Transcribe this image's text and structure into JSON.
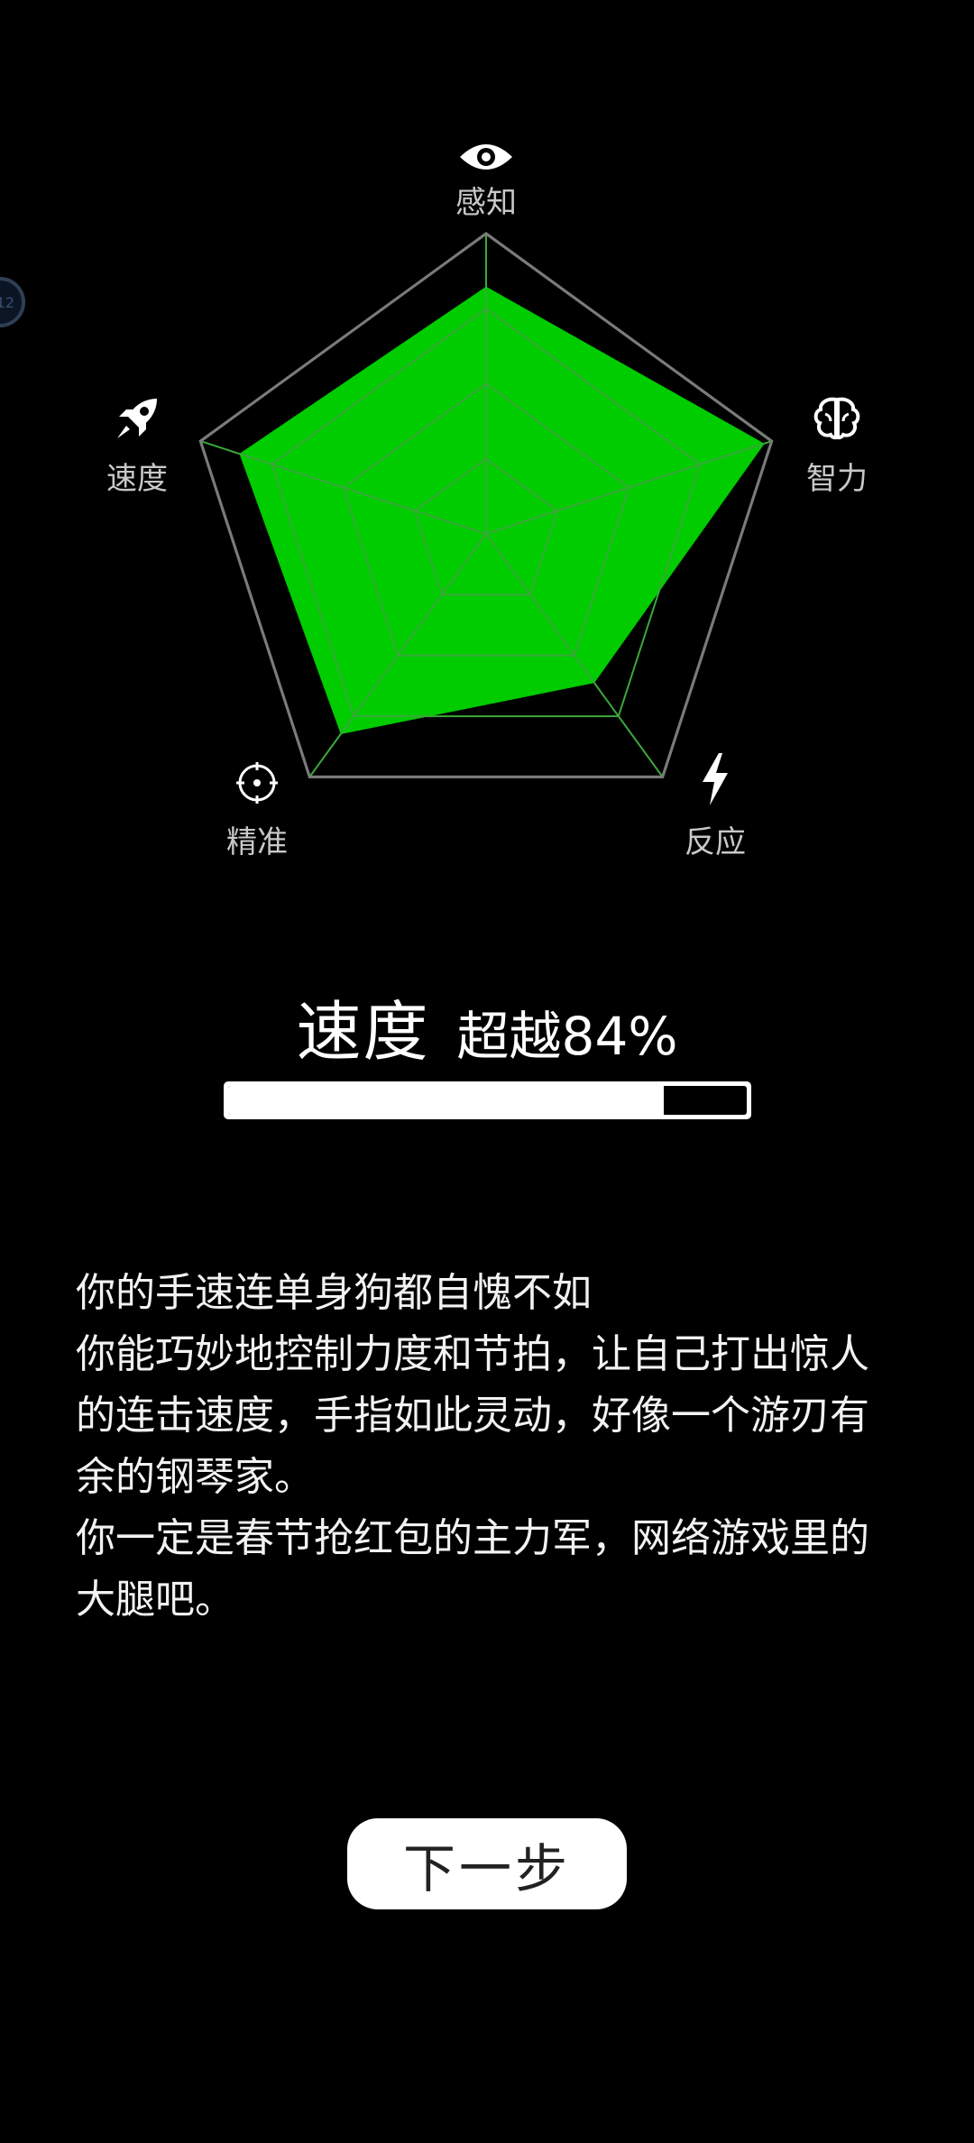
{
  "radar": {
    "axes": [
      {
        "key": "perception",
        "label": "感知",
        "icon": "eye-icon",
        "value": 0.82
      },
      {
        "key": "intelligence",
        "label": "智力",
        "icon": "brain-icon",
        "value": 0.97
      },
      {
        "key": "reaction",
        "label": "反应",
        "icon": "lightning-icon",
        "value": 0.61
      },
      {
        "key": "precision",
        "label": "精准",
        "icon": "crosshair-icon",
        "value": 0.82
      },
      {
        "key": "speed",
        "label": "速度",
        "icon": "rocket-icon",
        "value": 0.86
      }
    ],
    "fill_color": "#00cc00",
    "grid_color": "#7a7a7a",
    "inner_grid_color": "#3aa83a",
    "rings": 4
  },
  "result": {
    "category": "速度",
    "percent_text": "超越84%",
    "percent_value": 0.84
  },
  "description": [
    "你的手速连单身狗都自愧不如",
    "你能巧妙地控制力度和节拍，让自己打出惊人的连击速度，手指如此灵动，好像一个游刃有余的钢琴家。",
    "你一定是春节抢红包的主力军，网络游戏里的大腿吧。"
  ],
  "next_button": {
    "label": "下一步"
  },
  "side_badge": {
    "text": "12"
  }
}
